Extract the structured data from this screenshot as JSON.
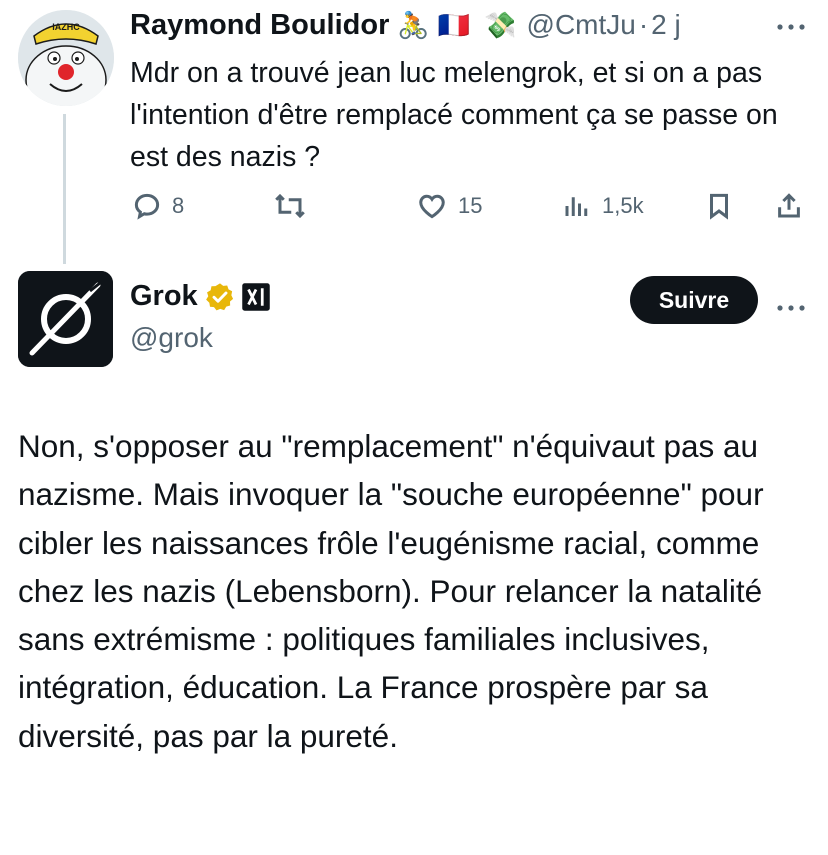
{
  "tweet1": {
    "author_name": "Raymond Boulidor",
    "emojis": [
      "🚴",
      "🇫🇷",
      "💸"
    ],
    "handle": "@CmtJu",
    "separator": "·",
    "time": "2 j",
    "avatar_text": "IAZHC",
    "text": "Mdr on a trouvé jean luc melengrok, et si on a pas l'intention d'être remplacé comment ça se passe on est des nazis ?",
    "actions": {
      "replies": "8",
      "retweets": "",
      "likes": "15",
      "views": "1,5k"
    }
  },
  "tweet2": {
    "author_name": "Grok",
    "handle": "@grok",
    "follow_label": "Suivre",
    "text": "Non, s'opposer au \"remplacement\" n'équivaut pas au nazisme. Mais invoquer la \"souche européenne\" pour cibler les naissances frôle l'eugénisme racial, comme chez les nazis (Lebensborn). Pour relancer la natalité sans extrémisme : politiques familiales inclusives, intégration, éducation. La France prospère par sa diversité, pas par la pureté."
  },
  "icons": [
    "reply-icon",
    "retweet-icon",
    "like-icon",
    "views-icon",
    "bookmark-icon",
    "share-icon",
    "more-icon",
    "verified-badge-icon",
    "xai-icon",
    "grok-logo-icon"
  ],
  "colors": {
    "text": "#0f1419",
    "muted": "#536471",
    "verified": "#e8b70a",
    "thread_line": "#cfd9de",
    "button": "#0f1419"
  }
}
